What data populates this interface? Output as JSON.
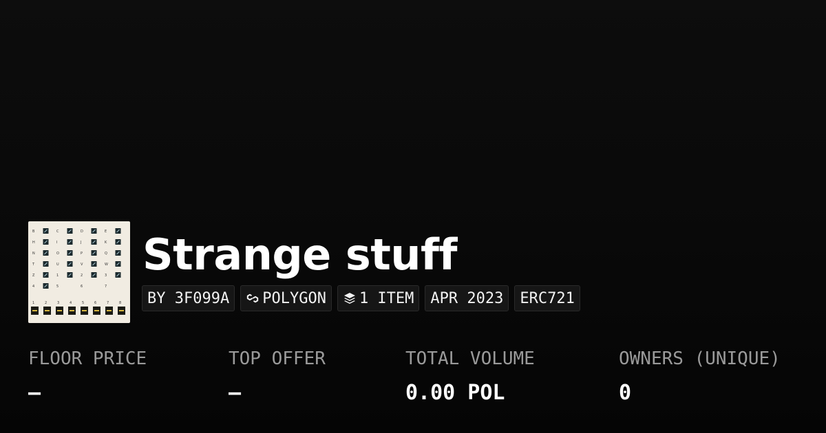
{
  "collection": {
    "title": "Strange stuff",
    "chips": {
      "creator": "BY 3F099A",
      "chain": "POLYGON",
      "items": "1 ITEM",
      "date": "APR 2023",
      "standard": "ERC721"
    },
    "icons": {
      "chain": "polygon-link-icon",
      "items": "layers-stack-icon"
    }
  },
  "stats": {
    "floor_price": {
      "label": "FLOOR PRICE",
      "value": "–"
    },
    "top_offer": {
      "label": "TOP OFFER",
      "value": "–"
    },
    "total_volume": {
      "label": "TOTAL VOLUME",
      "value": "0.00 POL"
    },
    "owners": {
      "label": "OWNERS (UNIQUE)",
      "value": "0"
    }
  },
  "thumbnail": {
    "glyph_labels": [
      "B",
      "C",
      "D",
      "E",
      "H",
      "I",
      "J",
      "K",
      "N",
      "O",
      "P",
      "Q",
      "T",
      "U",
      "V",
      "W",
      "Z",
      "1",
      "2",
      "3",
      "4",
      "5",
      "6",
      "7",
      "8",
      "9"
    ]
  },
  "colors": {
    "background": "#0a0a0a",
    "text": "#ffffff",
    "muted": "#9a9a9a",
    "chip_bg": "#161616",
    "thumb_bg": "#f1ece2"
  }
}
